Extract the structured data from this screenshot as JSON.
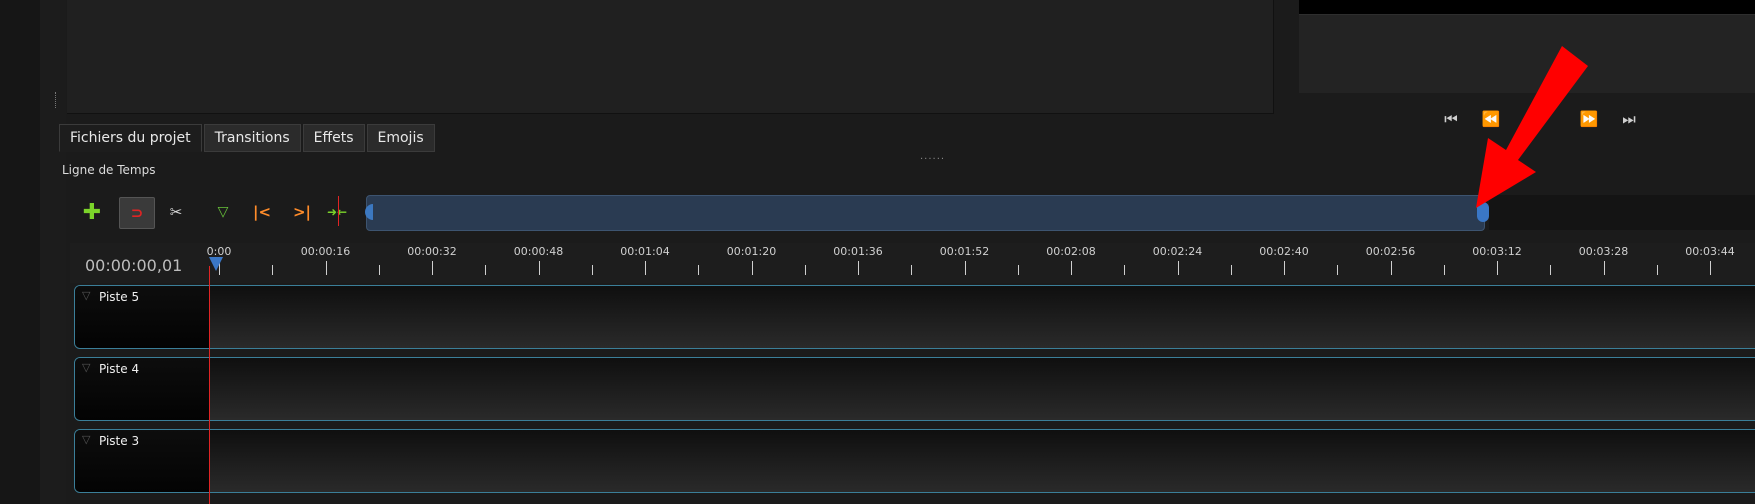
{
  "tabs": [
    {
      "label": "Fichiers du projet",
      "active": true
    },
    {
      "label": "Transitions",
      "active": false
    },
    {
      "label": "Effets",
      "active": false
    },
    {
      "label": "Emojis",
      "active": false
    }
  ],
  "panel_handle": "......",
  "timeline": {
    "label": "Ligne de Temps",
    "current_time": "00:00:00,01",
    "ruler_labels": [
      "0:00",
      "00:00:16",
      "00:00:32",
      "00:00:48",
      "00:01:04",
      "00:01:20",
      "00:01:36",
      "00:01:52",
      "00:02:08",
      "00:02:24",
      "00:02:40",
      "00:02:56",
      "00:03:12",
      "00:03:28",
      "00:03:44"
    ],
    "tracks": [
      {
        "name": "Piste 5"
      },
      {
        "name": "Piste 4"
      },
      {
        "name": "Piste 3"
      }
    ]
  },
  "toolbar": {
    "add_track_glyph": "✚",
    "snap_glyph": "⊃",
    "razor_glyph": "✂",
    "add_marker_glyph": "▽",
    "prev_marker_glyph": "|<",
    "next_marker_glyph": ">|",
    "center_glyph": "➜←"
  },
  "playback": {
    "first_glyph": "⏮",
    "rewind_glyph": "⏪",
    "fastforward_glyph": "⏩",
    "last_glyph": "⏭"
  },
  "colors": {
    "accent": "#3a77c6",
    "playhead": "#e02424",
    "annotation": "#ff0000"
  },
  "icons": [
    "plus-icon",
    "magnet-icon",
    "razor-icon",
    "marker-icon",
    "previous-marker-icon",
    "next-marker-icon",
    "center-playhead-icon",
    "jump-start-icon",
    "rewind-icon",
    "fast-forward-icon",
    "jump-end-icon",
    "annotation-arrow-icon"
  ]
}
